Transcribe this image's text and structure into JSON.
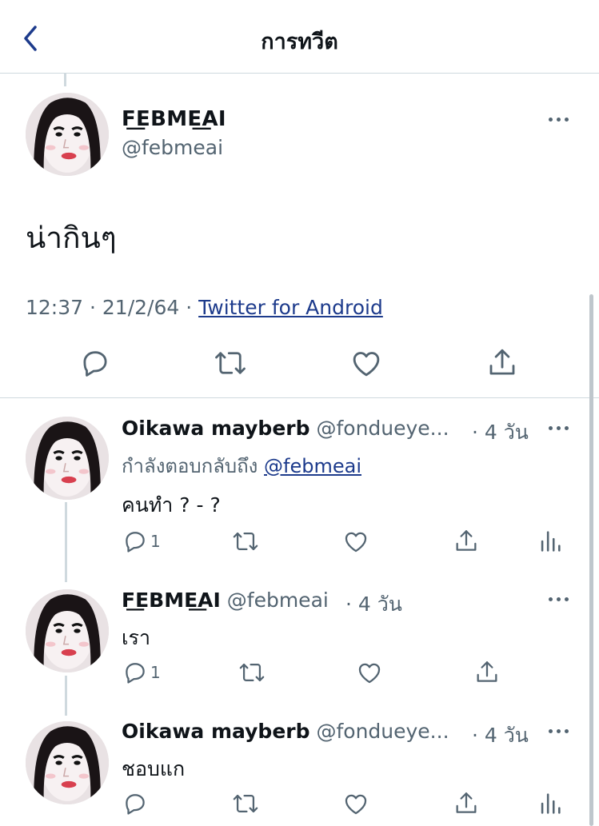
{
  "header": {
    "title": "การทวีต"
  },
  "main_tweet": {
    "display_name": "F͟EBME͟AI",
    "handle": "@febmeai",
    "text": "น่ากินๆ",
    "time": "12:37 · 21/2/64 · ",
    "source": "Twitter for Android"
  },
  "replies": [
    {
      "display_name": "Oikawa mayberb",
      "handle": "@fondueye...",
      "time": "· 4 วัน",
      "replying_label": "กำลังตอบกลับถึง ",
      "replying_to": "@febmeai",
      "text": "คนทำ ? - ?",
      "reply_count": "1"
    },
    {
      "display_name": "F͟EBME͟AI",
      "handle": "@febmeai",
      "time": "· 4 วัน",
      "text": "เรา",
      "reply_count": "1"
    },
    {
      "display_name": "Oikawa mayberb",
      "handle": "@fondueye...",
      "time": "· 4 วัน",
      "text": "ชอบแก",
      "reply_count": ""
    }
  ],
  "icons": {
    "back": "chevron-left-icon",
    "more": "more-horizontal-icon",
    "reply": "reply-bubble-icon",
    "retweet": "retweet-icon",
    "like": "heart-icon",
    "share": "share-icon",
    "analytics": "analytics-bars-icon"
  },
  "colors": {
    "accent": "#1d3b8c",
    "secondary_text": "#536471",
    "divider": "#cfd9de"
  }
}
